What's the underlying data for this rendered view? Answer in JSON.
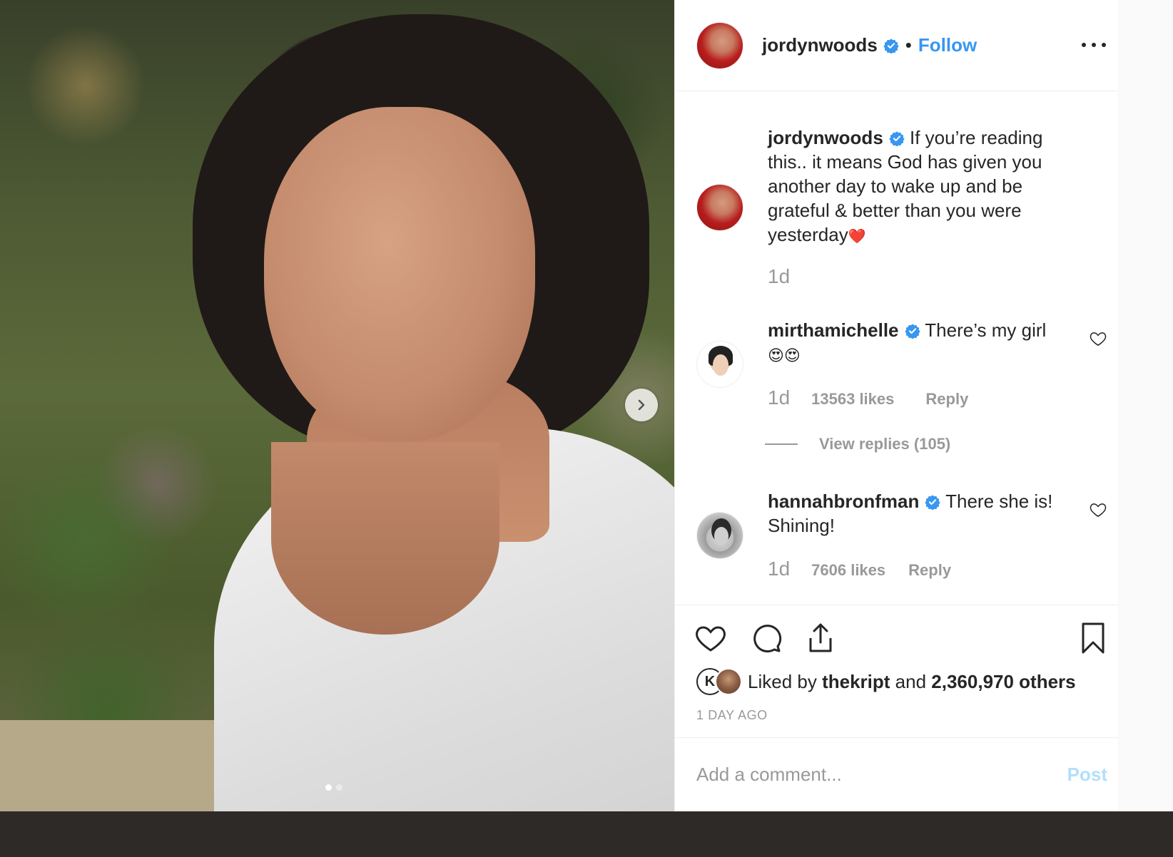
{
  "post": {
    "username": "jordynwoods",
    "separator": "•",
    "follow_label": "Follow",
    "caption": {
      "username": "jordynwoods",
      "text": "If you’re reading this.. it means God has given you another day to wake up and be grateful & better than you were yesterday",
      "emoji": "❤️",
      "time": "1d"
    }
  },
  "comments": [
    {
      "username": "mirthamichelle",
      "text": "There’s my girl",
      "emoji": "😍😍",
      "time": "1d",
      "likes": "13563 likes",
      "reply_label": "Reply",
      "view_replies": "View replies (105)"
    },
    {
      "username": "hannahbronfman",
      "text": "There she is! Shining!",
      "time": "1d",
      "likes": "7606 likes",
      "reply_label": "Reply"
    }
  ],
  "likes": {
    "prefix": "Liked by",
    "first_user": "thekript",
    "joiner": "and",
    "others": "2,360,970 others",
    "avatar_letter": "K"
  },
  "post_date": "1 DAY AGO",
  "add_comment": {
    "placeholder": "Add a comment...",
    "post_label": "Post"
  },
  "icons": {
    "verified": "verified-badge-icon",
    "more": "more-options-icon",
    "heart": "heart-icon",
    "comment": "comment-icon",
    "share": "share-icon",
    "bookmark": "bookmark-icon",
    "next": "chevron-right-icon"
  },
  "colors": {
    "accent": "#3897f0",
    "post_disabled": "#b2dffc",
    "muted": "#999999",
    "text": "#262626"
  },
  "carousel": {
    "total": 2,
    "active": 1
  }
}
